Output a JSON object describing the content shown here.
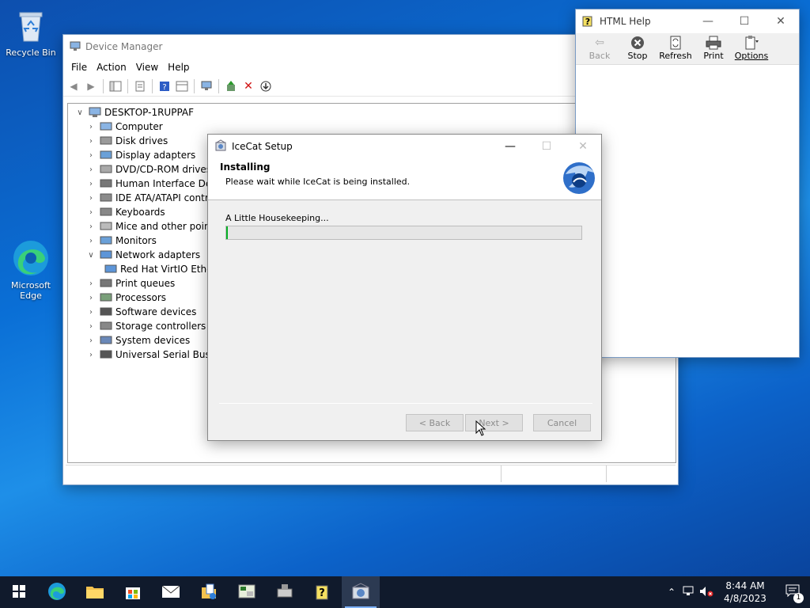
{
  "desktop": {
    "recycle_bin": "Recycle Bin",
    "edge_line1": "Microsoft",
    "edge_line2": "Edge"
  },
  "device_manager": {
    "title": "Device Manager",
    "menu": [
      "File",
      "Action",
      "View",
      "Help"
    ],
    "root": "DESKTOP-1RUPPAF",
    "nodes": [
      {
        "label": "Computer",
        "expanded": false
      },
      {
        "label": "Disk drives",
        "expanded": false
      },
      {
        "label": "Display adapters",
        "expanded": false
      },
      {
        "label": "DVD/CD-ROM drives",
        "expanded": false
      },
      {
        "label": "Human Interface Devi",
        "expanded": false
      },
      {
        "label": "IDE ATA/ATAPI control",
        "expanded": false
      },
      {
        "label": "Keyboards",
        "expanded": false
      },
      {
        "label": "Mice and other pointi",
        "expanded": false
      },
      {
        "label": "Monitors",
        "expanded": false
      },
      {
        "label": "Network adapters",
        "expanded": true
      },
      {
        "label": "Red Hat VirtIO Ethe",
        "child": true
      },
      {
        "label": "Print queues",
        "expanded": false
      },
      {
        "label": "Processors",
        "expanded": false
      },
      {
        "label": "Software devices",
        "expanded": false
      },
      {
        "label": "Storage controllers",
        "expanded": false
      },
      {
        "label": "System devices",
        "expanded": false
      },
      {
        "label": "Universal Serial Bus co",
        "expanded": false
      }
    ]
  },
  "html_help": {
    "title": "HTML Help",
    "back": "Back",
    "stop": "Stop",
    "refresh": "Refresh",
    "print": "Print",
    "options": "Options"
  },
  "setup": {
    "title": "IceCat Setup",
    "heading": "Installing",
    "subheading": "Please wait while IceCat is being installed.",
    "status": "A Little Housekeeping...",
    "progress": 0.005,
    "back": "< Back",
    "next": "Next >",
    "cancel": "Cancel"
  },
  "taskbar": {
    "time": "8:44 AM",
    "date": "4/8/2023",
    "notification_count": "1"
  },
  "colors": {
    "progress_green": "#06b025",
    "taskbar": "#101a2c"
  }
}
